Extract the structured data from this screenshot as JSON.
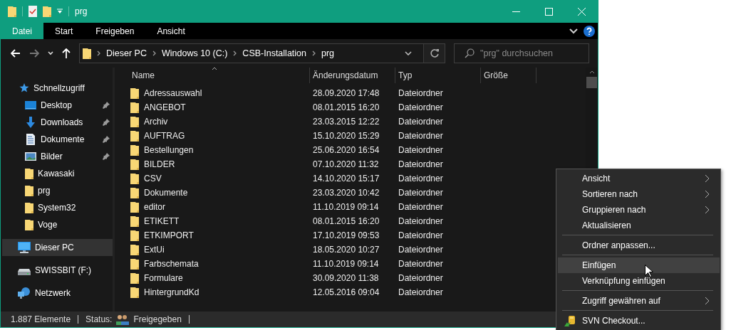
{
  "window": {
    "title": "prg"
  },
  "ribbon_tabs": [
    {
      "label": "Datei",
      "selected": true
    },
    {
      "label": "Start",
      "selected": false
    },
    {
      "label": "Freigeben",
      "selected": false
    },
    {
      "label": "Ansicht",
      "selected": false
    }
  ],
  "navigation": {
    "back_enabled": true,
    "forward_enabled": false
  },
  "breadcrumb": [
    "Dieser PC",
    "Windows 10 (C:)",
    "CSB-Installation",
    "prg"
  ],
  "search": {
    "placeholder": "\"prg\" durchsuchen"
  },
  "sidebar": [
    {
      "label": "Schnellzugriff",
      "kind": "quick",
      "selected": false,
      "children": [
        {
          "label": "Desktop",
          "kind": "desktop",
          "pinned": true,
          "selected": false
        },
        {
          "label": "Downloads",
          "kind": "downloads",
          "pinned": true,
          "selected": false
        },
        {
          "label": "Dokumente",
          "kind": "documents",
          "pinned": true,
          "selected": false
        },
        {
          "label": "Bilder",
          "kind": "pictures",
          "pinned": true,
          "selected": false
        },
        {
          "label": "Kawasaki",
          "kind": "folder",
          "pinned": false,
          "selected": false
        },
        {
          "label": "prg",
          "kind": "folder",
          "pinned": false,
          "selected": false
        },
        {
          "label": "System32",
          "kind": "folder",
          "pinned": false,
          "selected": false
        },
        {
          "label": "Voge",
          "kind": "folder",
          "pinned": false,
          "selected": false
        }
      ]
    },
    {
      "label": "Dieser PC",
      "kind": "pc",
      "selected": true
    },
    {
      "label": "SWISSBIT (F:)",
      "kind": "drive",
      "selected": false
    },
    {
      "label": "Netzwerk",
      "kind": "network",
      "selected": false
    }
  ],
  "table": {
    "columns": [
      {
        "label": "Name",
        "sorted": true
      },
      {
        "label": "Änderungsdatum",
        "sorted": false
      },
      {
        "label": "Typ",
        "sorted": false
      },
      {
        "label": "Größe",
        "sorted": false
      }
    ],
    "rows": [
      {
        "name": "Adressauswahl",
        "date": "28.09.2020 17:48",
        "type": "Dateiordner"
      },
      {
        "name": "ANGEBOT",
        "date": "08.01.2015 16:20",
        "type": "Dateiordner"
      },
      {
        "name": "Archiv",
        "date": "23.03.2015 12:22",
        "type": "Dateiordner"
      },
      {
        "name": "AUFTRAG",
        "date": "15.10.2020 15:29",
        "type": "Dateiordner"
      },
      {
        "name": "Bestellungen",
        "date": "25.06.2020 16:54",
        "type": "Dateiordner"
      },
      {
        "name": "BILDER",
        "date": "07.10.2020 11:32",
        "type": "Dateiordner"
      },
      {
        "name": "CSV",
        "date": "14.10.2020 15:17",
        "type": "Dateiordner"
      },
      {
        "name": "Dokumente",
        "date": "23.03.2020 10:42",
        "type": "Dateiordner"
      },
      {
        "name": "editor",
        "date": "11.10.2019 09:14",
        "type": "Dateiordner"
      },
      {
        "name": "ETIKETT",
        "date": "08.01.2015 16:20",
        "type": "Dateiordner"
      },
      {
        "name": "ETKIMPORT",
        "date": "17.10.2019 09:53",
        "type": "Dateiordner"
      },
      {
        "name": "ExtUi",
        "date": "18.05.2020 10:27",
        "type": "Dateiordner"
      },
      {
        "name": "Farbschemata",
        "date": "11.10.2019 09:14",
        "type": "Dateiordner"
      },
      {
        "name": "Formulare",
        "date": "30.09.2020 11:38",
        "type": "Dateiordner"
      },
      {
        "name": "HintergrundKd",
        "date": "12.05.2016 09:04",
        "type": "Dateiordner"
      }
    ]
  },
  "status_bar": {
    "count": "1.887 Elemente",
    "status_label": "Status:",
    "status_value": "Freigegeben"
  },
  "context_menu": {
    "groups": [
      [
        {
          "label": "Ansicht",
          "kind": "text",
          "submenu": true,
          "selected": false
        },
        {
          "label": "Sortieren nach",
          "kind": "text",
          "submenu": true,
          "selected": false
        },
        {
          "label": "Gruppieren nach",
          "kind": "text",
          "submenu": true,
          "selected": false
        },
        {
          "label": "Aktualisieren",
          "kind": "text",
          "submenu": false,
          "selected": false
        }
      ],
      [
        {
          "label": "Ordner anpassen...",
          "kind": "text",
          "submenu": false,
          "selected": false
        }
      ],
      [
        {
          "label": "Einfügen",
          "kind": "text",
          "submenu": false,
          "selected": true
        },
        {
          "label": "Verknüpfung einfügen",
          "kind": "text",
          "submenu": false,
          "selected": false
        }
      ],
      [
        {
          "label": "Zugriff gewähren auf",
          "kind": "text",
          "submenu": true,
          "selected": false
        }
      ],
      [
        {
          "label": "SVN Checkout...",
          "kind": "svn",
          "submenu": false,
          "selected": false
        }
      ]
    ]
  }
}
